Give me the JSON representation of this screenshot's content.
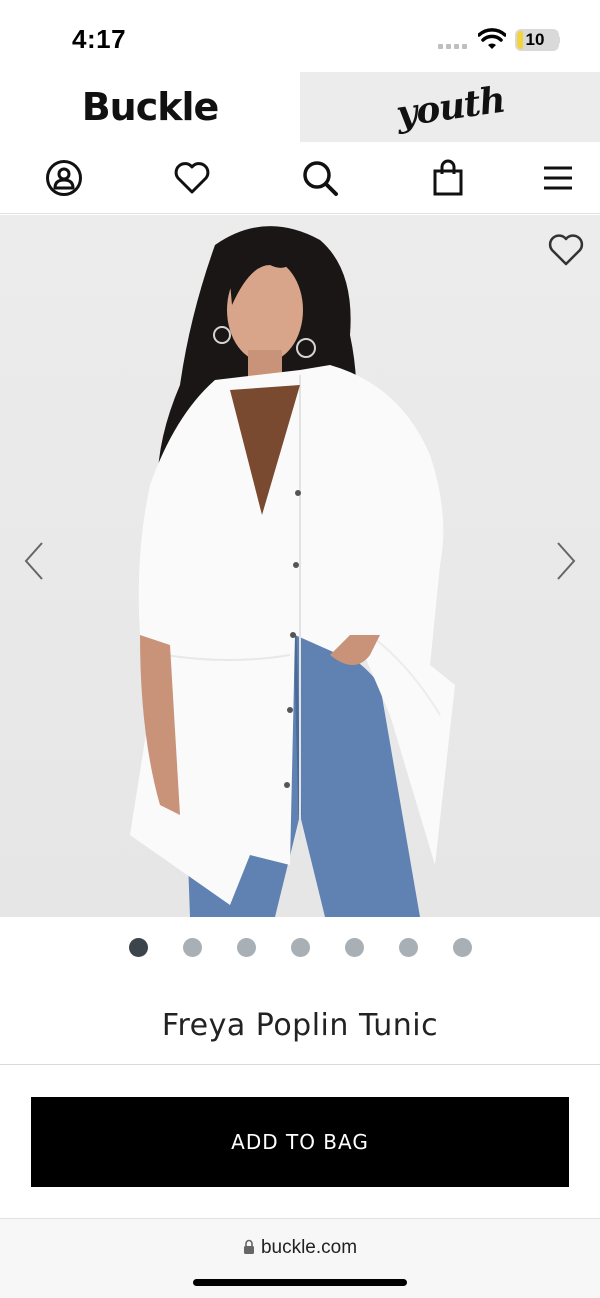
{
  "status_bar": {
    "time": "4:17",
    "battery": "10"
  },
  "brand": {
    "logo": "Buckle",
    "youth": "youth"
  },
  "nav": {
    "icons": [
      "account-icon",
      "wishlist-heart-icon",
      "search-icon",
      "shopping-bag-icon",
      "menu-icon"
    ]
  },
  "carousel": {
    "dot_count": 7,
    "active_index": 0
  },
  "product": {
    "title": "Freya Poplin Tunic"
  },
  "actions": {
    "add_to_bag": "ADD TO BAG"
  },
  "browser": {
    "url": "buckle.com"
  },
  "colors": {
    "accent": "#000000",
    "dot_active": "#3d454c",
    "dot_inactive": "#a8b0b5"
  }
}
